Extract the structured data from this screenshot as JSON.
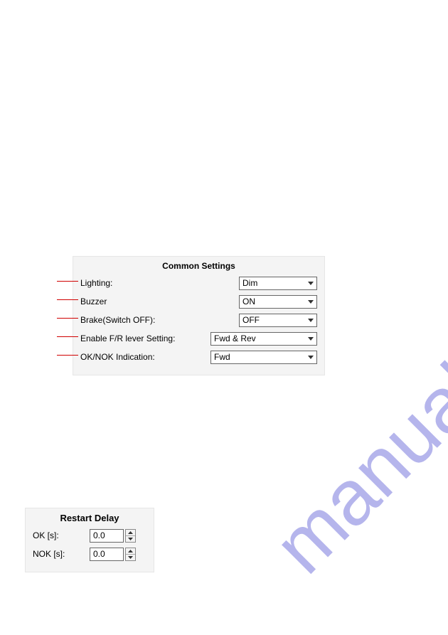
{
  "watermark": "manualshive.com",
  "common_settings": {
    "title": "Common Settings",
    "rows": [
      {
        "label": "Lighting:",
        "value": "Dim"
      },
      {
        "label": "Buzzer",
        "value": "ON"
      },
      {
        "label": "Brake(Switch OFF):",
        "value": "OFF"
      },
      {
        "label": "Enable F/R lever Setting:",
        "value": "Fwd & Rev"
      },
      {
        "label": "OK/NOK Indication:",
        "value": "Fwd"
      }
    ]
  },
  "restart_delay": {
    "title": "Restart Delay",
    "rows": [
      {
        "label": "OK [s]:",
        "value": "0.0"
      },
      {
        "label": "NOK [s]:",
        "value": "0.0"
      }
    ]
  }
}
